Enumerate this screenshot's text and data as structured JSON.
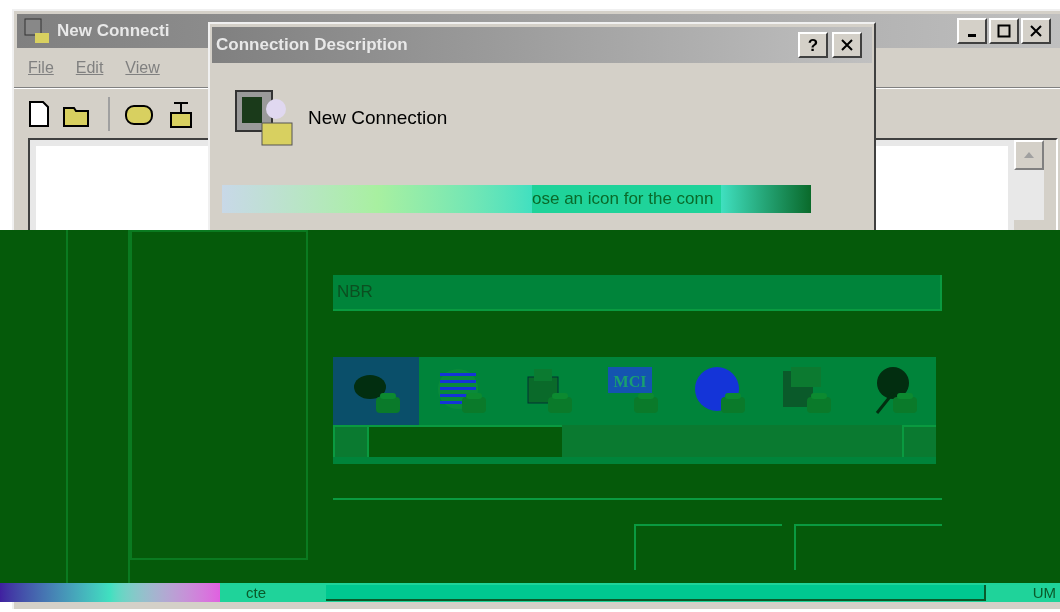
{
  "main_window": {
    "title": "New Connecti",
    "menu": [
      "File",
      "Edit",
      "View"
    ]
  },
  "dialog": {
    "title": "Connection Description",
    "help_button": "?",
    "heading": "New Connection",
    "instruction": "ose an icon for the conn",
    "name_field": {
      "value": "NBR"
    },
    "icons": [
      {
        "kind": "phone",
        "selected": true
      },
      {
        "kind": "striped-globe",
        "selected": false
      },
      {
        "kind": "fax",
        "selected": false
      },
      {
        "kind": "logo",
        "label": "MCI",
        "selected": false
      },
      {
        "kind": "globe",
        "selected": false
      },
      {
        "kind": "documents",
        "selected": false
      },
      {
        "kind": "umbrella",
        "selected": false
      }
    ]
  },
  "status_bar": [
    "cte",
    "UM"
  ]
}
